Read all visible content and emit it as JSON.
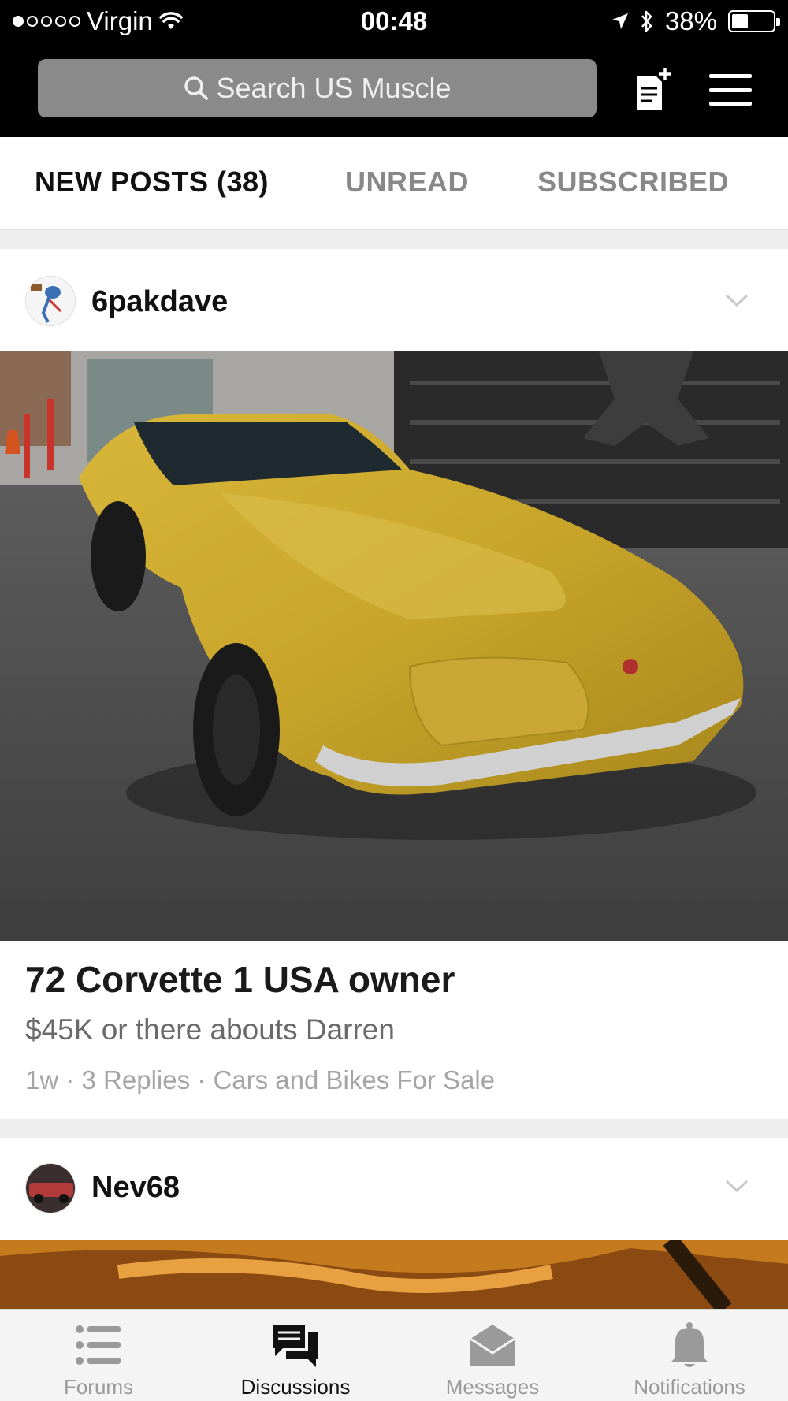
{
  "status_bar": {
    "carrier": "Virgin",
    "time": "00:48",
    "battery": "38%",
    "battery_level": 0.38,
    "signal_bars_filled": 1,
    "signal_bars_total": 5
  },
  "header": {
    "search_placeholder": "Search US Muscle",
    "icons": [
      "search-icon",
      "compose-icon",
      "menu-icon"
    ]
  },
  "tabs": [
    {
      "label": "NEW POSTS (38)",
      "active": true
    },
    {
      "label": "UNREAD",
      "active": false
    },
    {
      "label": "SUBSCRIBED",
      "active": false
    }
  ],
  "posts": [
    {
      "username": "6pakdave",
      "title": "72 Corvette 1 USA owner",
      "body": "$45K or there abouts Darren",
      "meta": {
        "age": "1w",
        "replies": "3 Replies",
        "forum": "Cars and Bikes For Sale"
      }
    },
    {
      "username": "Nev68"
    }
  ],
  "bottom_nav": [
    {
      "label": "Forums",
      "icon": "list-icon",
      "active": false
    },
    {
      "label": "Discussions",
      "icon": "chat-bubbles-icon",
      "active": true
    },
    {
      "label": "Messages",
      "icon": "envelope-icon",
      "active": false
    },
    {
      "label": "Notifications",
      "icon": "bell-icon",
      "active": false
    }
  ],
  "colors": {
    "header_bg": "#000000",
    "search_bg": "#8a8a8a",
    "active_text": "#111111",
    "inactive_text": "#888888",
    "car_color": "#c9a62a"
  }
}
